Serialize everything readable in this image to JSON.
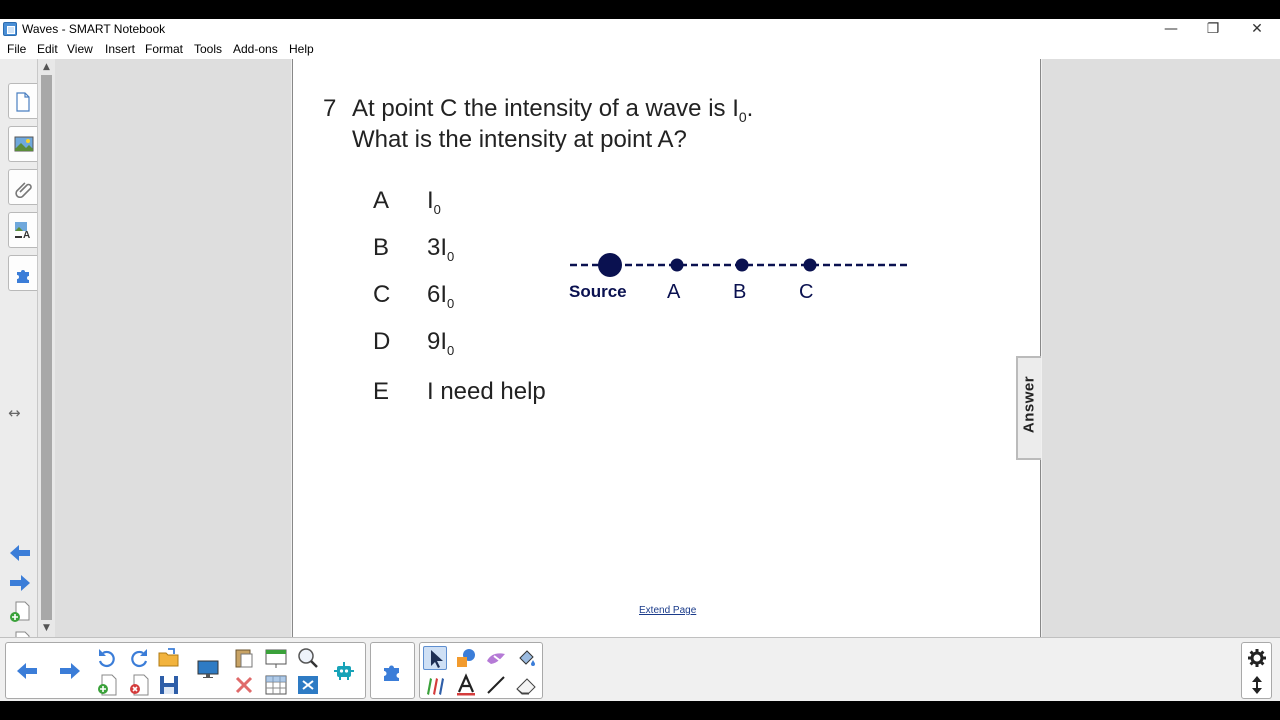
{
  "window": {
    "title": "Waves - SMART Notebook",
    "minimize_glyph": "—",
    "restore_glyph": "❐",
    "close_glyph": "✕"
  },
  "menu": [
    "File",
    "Edit",
    "View",
    "Insert",
    "Format",
    "Tools",
    "Add-ons",
    "Help"
  ],
  "side_tabs": [
    "page-sorter-icon",
    "gallery-icon",
    "attachments-icon",
    "properties-icon",
    "add-ons-icon"
  ],
  "question": {
    "number": "7",
    "line1_pre": "At point C the intensity of a wave is I",
    "line1_sub": "0",
    "line1_post": ".",
    "line2": "What is the intensity at point A?"
  },
  "choices": [
    {
      "letter": "A",
      "main": "I",
      "sub": "0"
    },
    {
      "letter": "B",
      "main": "3I",
      "sub": "0"
    },
    {
      "letter": "C",
      "main": "6I",
      "sub": "0"
    },
    {
      "letter": "D",
      "main": "9I",
      "sub": "0"
    },
    {
      "letter": "E",
      "main": "I need help",
      "sub": ""
    }
  ],
  "diagram": {
    "source_label": "Source",
    "point_labels": [
      "A",
      "B",
      "C"
    ],
    "color": "#0a1150"
  },
  "extend_page": "Extend Page",
  "answer_tab": "Answer",
  "nav": {
    "resize_glyph": "↔",
    "scroll_up_glyph": "▲",
    "scroll_down_glyph": "▼"
  },
  "colors": {
    "arrow_blue": "#3b7dd8",
    "accent": "#5f8fd0"
  }
}
